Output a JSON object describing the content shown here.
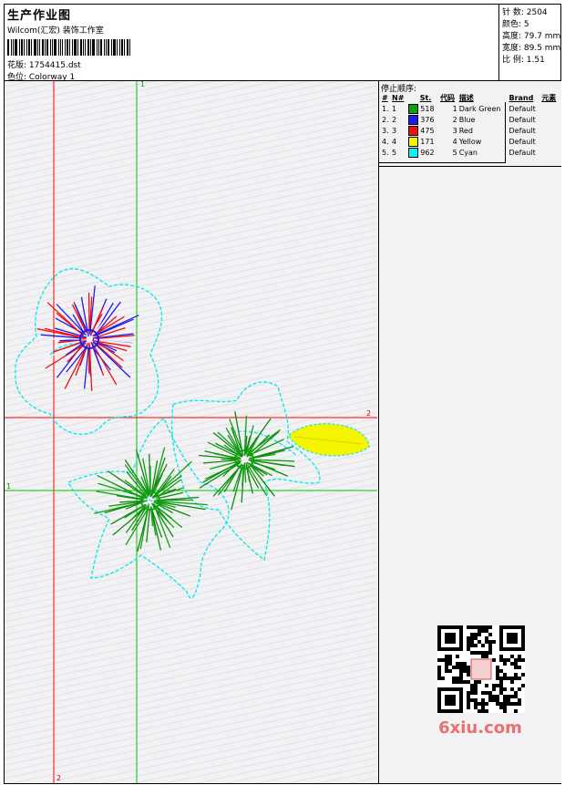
{
  "header": {
    "title": "生产作业图",
    "studio": "Wilcom(汇宏) 装饰工作室",
    "design_label": "花版: 1754415.dst",
    "colorway_label": "色位: Colorway 1"
  },
  "stats": {
    "stitches": "针 数: 2504",
    "colors": "颜色: 5",
    "height": "高度: 79.7 mm",
    "width": "宽度: 89.5 mm",
    "scale": "比 例: 1.51"
  },
  "guides": {
    "top_green": "1",
    "right_red": "2",
    "left_green": "1",
    "bottom_red": "2"
  },
  "legend": {
    "title": "停止顺序:",
    "headers": [
      "#",
      "N#",
      "St.",
      "代码",
      "描述",
      "Brand",
      "元素"
    ],
    "rows": [
      {
        "idx": "1.",
        "n": "1",
        "color": "#10a010",
        "st": "518",
        "code": "1",
        "desc": "Dark Green",
        "brand": "Default"
      },
      {
        "idx": "2.",
        "n": "2",
        "color": "#1c1cf0",
        "st": "376",
        "code": "2",
        "desc": "Blue",
        "brand": "Default"
      },
      {
        "idx": "3.",
        "n": "3",
        "color": "#f01010",
        "st": "475",
        "code": "3",
        "desc": "Red",
        "brand": "Default"
      },
      {
        "idx": "4.",
        "n": "4",
        "color": "#f5f500",
        "st": "171",
        "code": "4",
        "desc": "Yellow",
        "brand": "Default"
      },
      {
        "idx": "5.",
        "n": "5",
        "color": "#10f0f0",
        "st": "962",
        "code": "5",
        "desc": "Cyan",
        "brand": "Default"
      }
    ]
  },
  "watermark": {
    "site": "6xiu.com"
  },
  "colors": {
    "guide_red": "#ff0000",
    "guide_green": "#00c800",
    "outline": "#10e8e8"
  }
}
